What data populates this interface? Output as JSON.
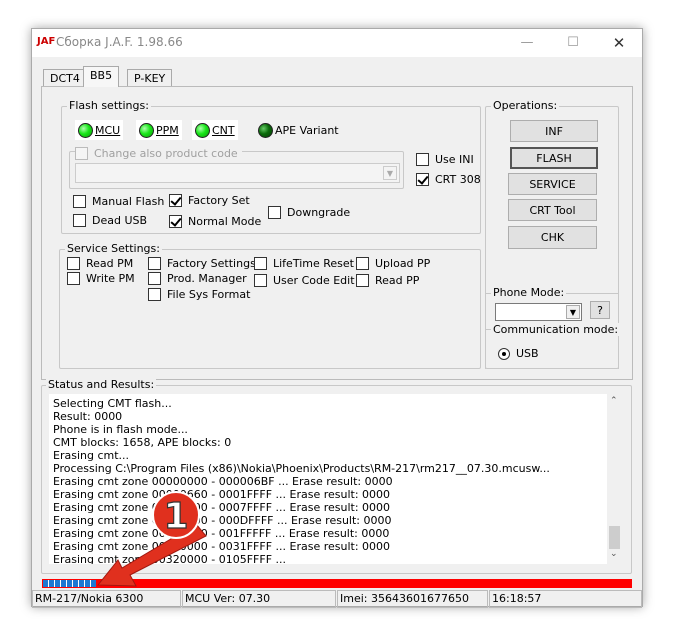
{
  "window": {
    "title": "Сборка J.A.F.  1.98.66",
    "icon": "jaf-logo-icon",
    "controls": [
      "minimize-icon",
      "maximize-icon",
      "close-icon"
    ]
  },
  "tabs": [
    {
      "label": "DCT4",
      "active": false
    },
    {
      "label": "BB5",
      "active": true
    },
    {
      "label": "P-KEY",
      "active": false
    }
  ],
  "flash_settings": {
    "title": "Flash settings:",
    "leds": [
      {
        "label": "MCU",
        "on": true
      },
      {
        "label": "PPM",
        "on": true
      },
      {
        "label": "CNT",
        "on": true
      },
      {
        "label": "APE Variant",
        "on": false
      }
    ],
    "change_product_code": {
      "label": "Change also product code",
      "checked": false,
      "enabled": false,
      "value": ""
    },
    "options": {
      "use_ini": {
        "label": "Use INI",
        "checked": false
      },
      "crt_308": {
        "label": "CRT 308",
        "checked": true
      },
      "manual_flash": {
        "label": "Manual Flash",
        "checked": false
      },
      "dead_usb": {
        "label": "Dead USB",
        "checked": false
      },
      "factory_set": {
        "label": "Factory Set",
        "checked": true
      },
      "normal_mode": {
        "label": "Normal Mode",
        "checked": true
      },
      "downgrade": {
        "label": "Downgrade",
        "checked": false
      }
    }
  },
  "service_settings": {
    "title": "Service Settings:",
    "options": {
      "read_pm": {
        "label": "Read PM",
        "checked": false
      },
      "write_pm": {
        "label": "Write PM",
        "checked": false
      },
      "factory_settings": {
        "label": "Factory Settings",
        "checked": false
      },
      "prod_manager": {
        "label": "Prod. Manager",
        "checked": false
      },
      "file_sys_format": {
        "label": "File Sys Format",
        "checked": false
      },
      "lifetime_reset": {
        "label": "LifeTime Reset",
        "checked": false
      },
      "user_code_edit": {
        "label": "User Code Edit",
        "checked": false
      },
      "upload_pp": {
        "label": "Upload PP",
        "checked": false
      },
      "read_pp": {
        "label": "Read PP",
        "checked": false
      }
    }
  },
  "operations": {
    "title": "Operations:",
    "buttons": [
      "INF",
      "FLASH",
      "SERVICE",
      "CRT Tool",
      "CHK"
    ]
  },
  "phone_mode": {
    "title": "Phone Mode:",
    "value": "",
    "help": "?"
  },
  "communication_mode": {
    "title": "Communication mode:",
    "option": "USB",
    "selected": true
  },
  "status": {
    "title": "Status and Results:",
    "lines": [
      "Selecting CMT flash...",
      "Result: 0000",
      "Phone is in flash mode...",
      "CMT blocks: 1658, APE blocks: 0",
      "Erasing cmt...",
      "Processing C:\\Program Files (x86)\\Nokia\\Phoenix\\Products\\RM-217\\rm217__07.30.mcusw...",
      "Erasing cmt zone 00000000 - 000006BF ... Erase result: 0000",
      "Erasing cmt zone 00000660 - 0001FFFF ... Erase result: 0000",
      "Erasing cmt zone 00020000 - 0007FFFF ... Erase result: 0000",
      "Erasing cmt zone 00080000 - 000DFFFF ... Erase result: 0000",
      "Erasing cmt zone 00100000 - 001FFFFF ... Erase result: 0000",
      "Erasing cmt zone 00200000 - 0031FFFF ... Erase result: 0000",
      "Erasing cmt zone 00320000 - 0105FFFF ..."
    ]
  },
  "progress": {
    "percent": 9,
    "bar_color": "#ff0000",
    "fill_color": "#1e78d2"
  },
  "statusbar": [
    "RM-217/Nokia 6300",
    "MCU Ver: 07.30",
    "Imei: 35643601677650",
    "16:18:57"
  ],
  "annotation": {
    "number": "1",
    "color": "#e0301e"
  }
}
